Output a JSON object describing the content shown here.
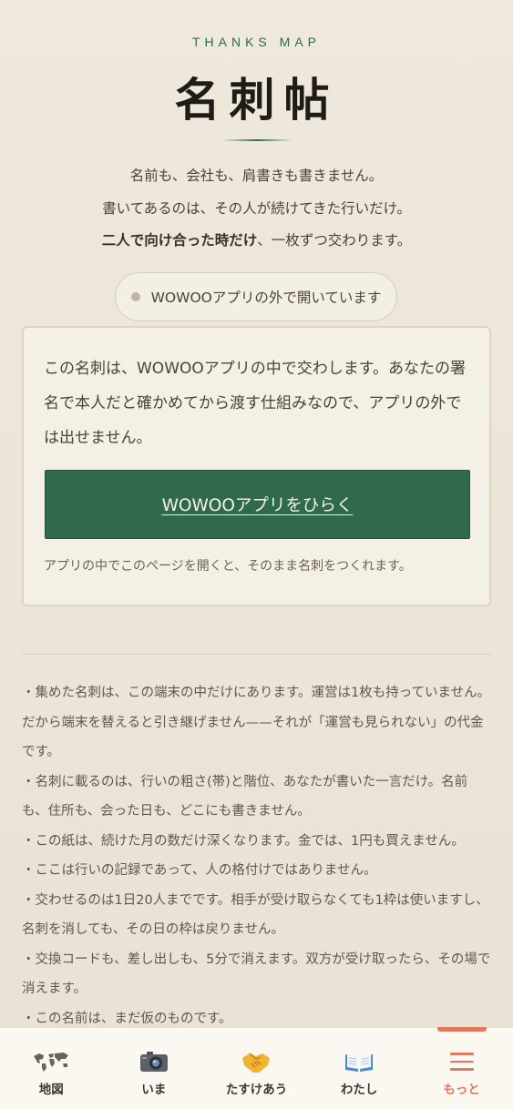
{
  "header": {
    "kicker": "THANKS MAP",
    "title": "名刺帖",
    "intro_line1": "名前も、会社も、肩書きも書きません。",
    "intro_line2": "書いてあるのは、その人が続けてきた行いだけ。",
    "intro_line3_bold": "二人で向け合った時だけ",
    "intro_line3_rest": "、一枚ずつ交わります。"
  },
  "status_pill": {
    "label": "WOWOOアプリの外で開いています"
  },
  "app_card": {
    "body": "この名刺は、WOWOOアプリの中で交わします。あなたの署名で本人だと確かめてから渡す仕組みなので、アプリの外では出せません。",
    "button_label": "WOWOOアプリをひらく",
    "note": "アプリの中でこのページを開くと、そのまま名刺をつくれます。"
  },
  "notes": [
    "・集めた名刺は、この端末の中だけにあります。運営は1枚も持っていません。だから端末を替えると引き継げません——それが「運営も見られない」の代金です。",
    "・名刺に載るのは、行いの粗さ(帯)と階位、あなたが書いた一言だけ。名前も、住所も、会った日も、どこにも書きません。",
    "・この紙は、続けた月の数だけ深くなります。金では、1円も買えません。",
    "・ここは行いの記録であって、人の格付けではありません。",
    "・交わせるのは1日20人までです。相手が受け取らなくても1枠は使いますし、名刺を消しても、その日の枠は戻りません。",
    "・交換コードも、差し出しも、5分で消えます。双方が受け取ったら、その場で消えます。",
    "・この名前は、まだ仮のものです。"
  ],
  "tabbar": {
    "active_tab": "もっと",
    "active_color": "#e07a5f",
    "tabs": [
      {
        "label": "地図",
        "icon": "world-map-icon"
      },
      {
        "label": "いま",
        "icon": "camera-icon"
      },
      {
        "label": "たすけあう",
        "icon": "handshake-icon"
      },
      {
        "label": "わたし",
        "icon": "open-book-icon"
      },
      {
        "label": "もっと",
        "icon": "menu-icon"
      }
    ]
  },
  "colors": {
    "accent_green": "#2f6a4e",
    "accent_orange": "#e07a5f",
    "background": "#efe8dc"
  }
}
